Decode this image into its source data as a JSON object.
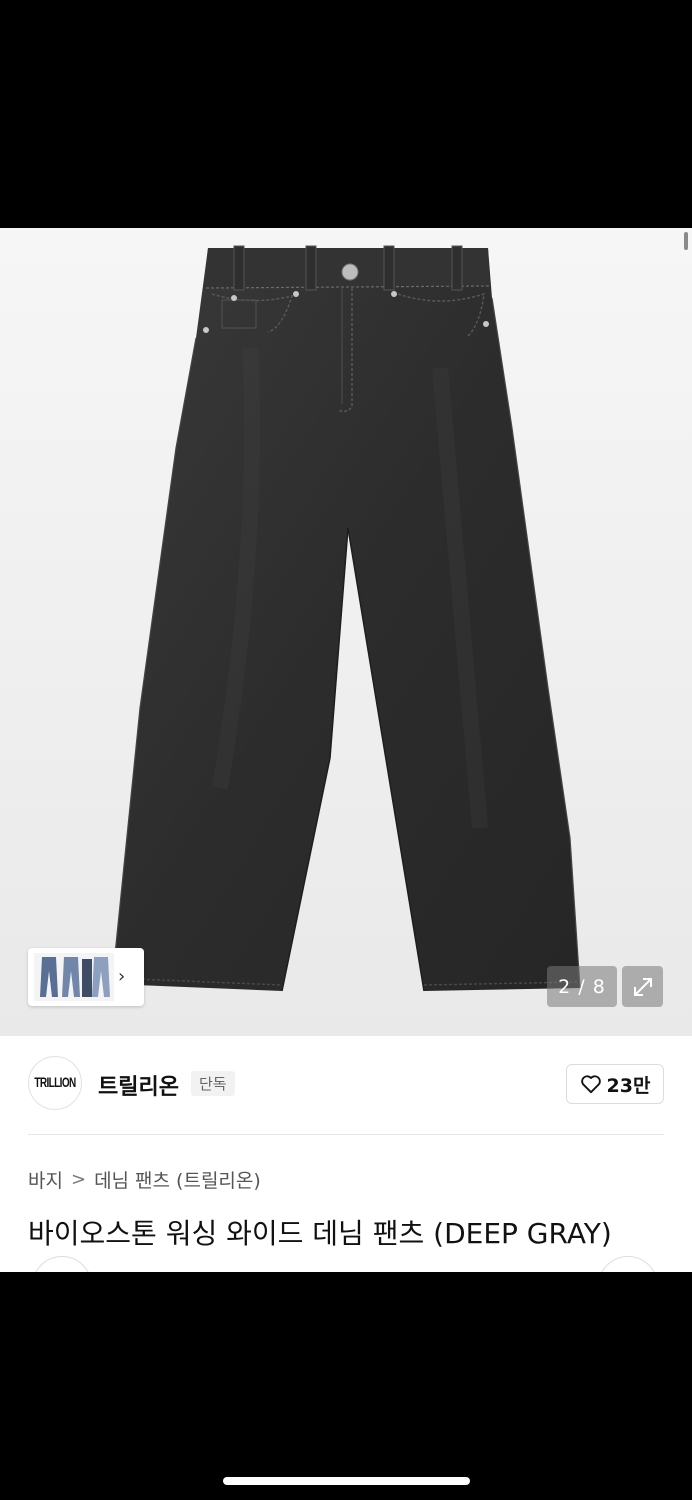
{
  "image_viewer": {
    "counter": "2 / 8",
    "expand_icon": "expand-arrows-icon",
    "thumbnail_chevron": "›"
  },
  "brand": {
    "logo_text": "TRILLION",
    "name": "트릴리온",
    "badge": "단독"
  },
  "like": {
    "icon": "heart-outline-icon",
    "count": "23만"
  },
  "breadcrumb": {
    "category": "바지",
    "separator": ">",
    "subcategory": "데님 팬츠 (트릴리온)"
  },
  "product": {
    "title": "바이오스톤 워싱 와이드 데님 팬츠 (DEEP GRAY)"
  },
  "colors": {
    "denim": "#2b2b2b",
    "hero_bg": "#efefef"
  }
}
